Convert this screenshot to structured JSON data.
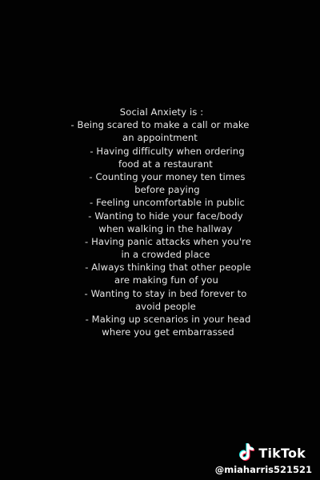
{
  "post": {
    "lines": [
      "Social Anxiety is :",
      "- Being scared to make a call or make",
      "an appointment",
      "- Having difficulty when ordering",
      "food at a restaurant",
      "- Counting your money ten times",
      "before paying",
      "- Feeling uncomfortable in public",
      "- Wanting to hide your face/body",
      "when walking in the hallway",
      "-  Having panic attacks when you're",
      "in a crowded place",
      "- Always thinking that other people",
      "are making fun of you",
      "- Wanting to stay in bed forever to",
      "avoid people",
      "- Making up scenarios in your head",
      "where you get embarrassed"
    ]
  },
  "watermark": {
    "brand": "TikTok",
    "handle": "@miaharris521521",
    "icon": "tiktok-logo-icon"
  },
  "colors": {
    "background": "#020202",
    "text": "#e6e6e6",
    "watermark": "#ffffff",
    "tiktok_cyan": "#25f4ee",
    "tiktok_red": "#fe2c55"
  }
}
